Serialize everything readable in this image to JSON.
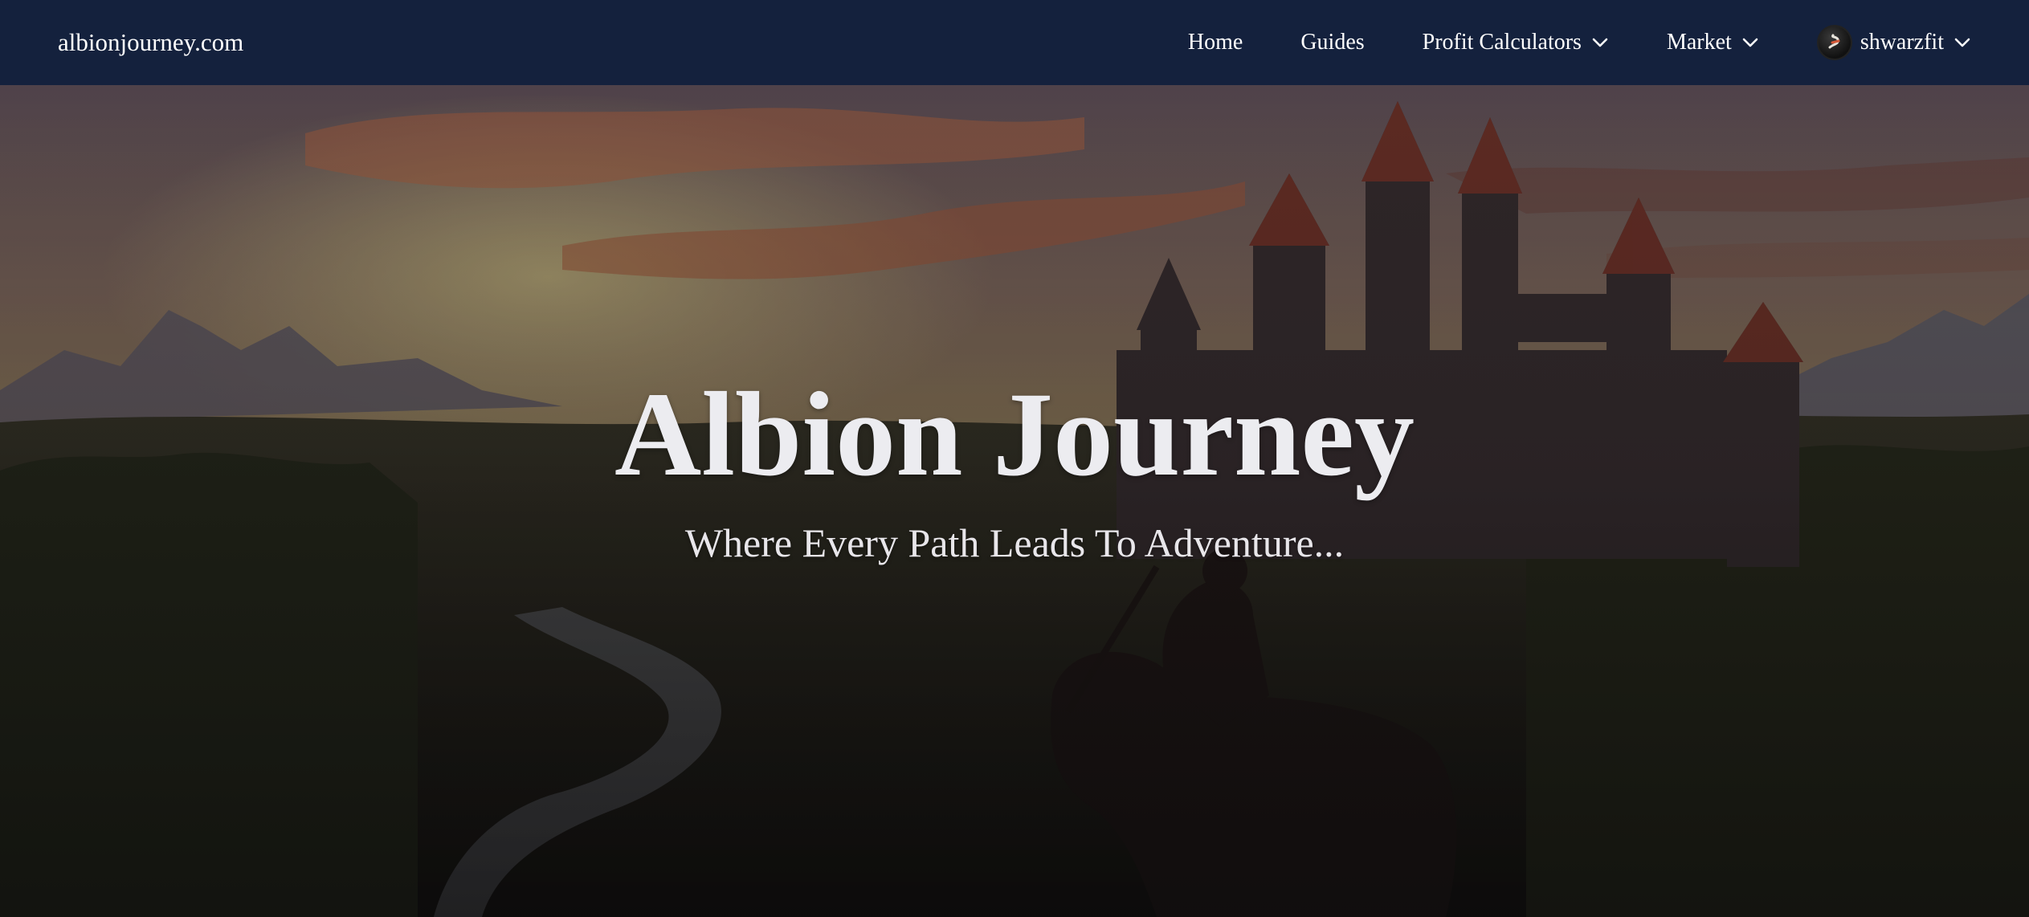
{
  "nav": {
    "brand": "albionjourney.com",
    "items": [
      {
        "label": "Home",
        "dropdown": false
      },
      {
        "label": "Guides",
        "dropdown": false
      },
      {
        "label": "Profit Calculators",
        "dropdown": true
      },
      {
        "label": "Market",
        "dropdown": true
      }
    ],
    "user": {
      "name": "shwarzfit",
      "dropdown": true,
      "avatar_icon": "avatar-icon"
    }
  },
  "hero": {
    "title": "Albion Journey",
    "subtitle": "Where Every Path Leads To Adventure..."
  },
  "colors": {
    "navbar_bg": "#14213d",
    "nav_text": "#ffffff",
    "hero_text": "#ececf0"
  }
}
